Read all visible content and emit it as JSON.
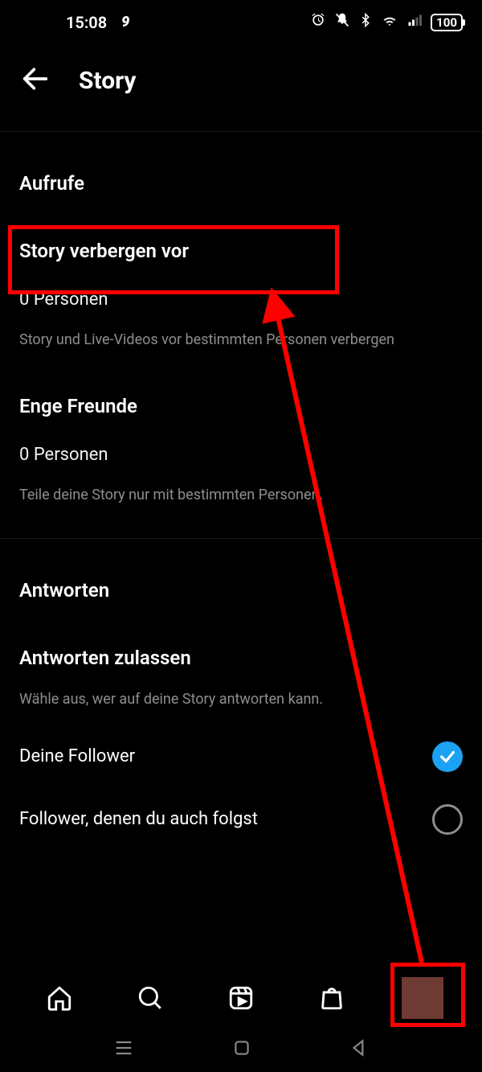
{
  "status": {
    "time": "15:08",
    "battery": "100"
  },
  "header": {
    "title": "Story"
  },
  "views": {
    "heading": "Aufrufe",
    "hide_from": {
      "label": "Story verbergen vor",
      "count": "0 Personen",
      "desc": "Story und Live-Videos vor bestimmten Personen verbergen"
    },
    "close_friends": {
      "label": "Enge Freunde",
      "count": "0 Personen",
      "desc": "Teile deine Story nur mit bestimmten Personen."
    }
  },
  "replies": {
    "heading": "Antworten",
    "allow_heading": "Antworten zulassen",
    "desc": "Wähle aus, wer auf deine Story antworten kann.",
    "option1": "Deine Follower",
    "option2": "Follower, denen du auch folgst"
  }
}
